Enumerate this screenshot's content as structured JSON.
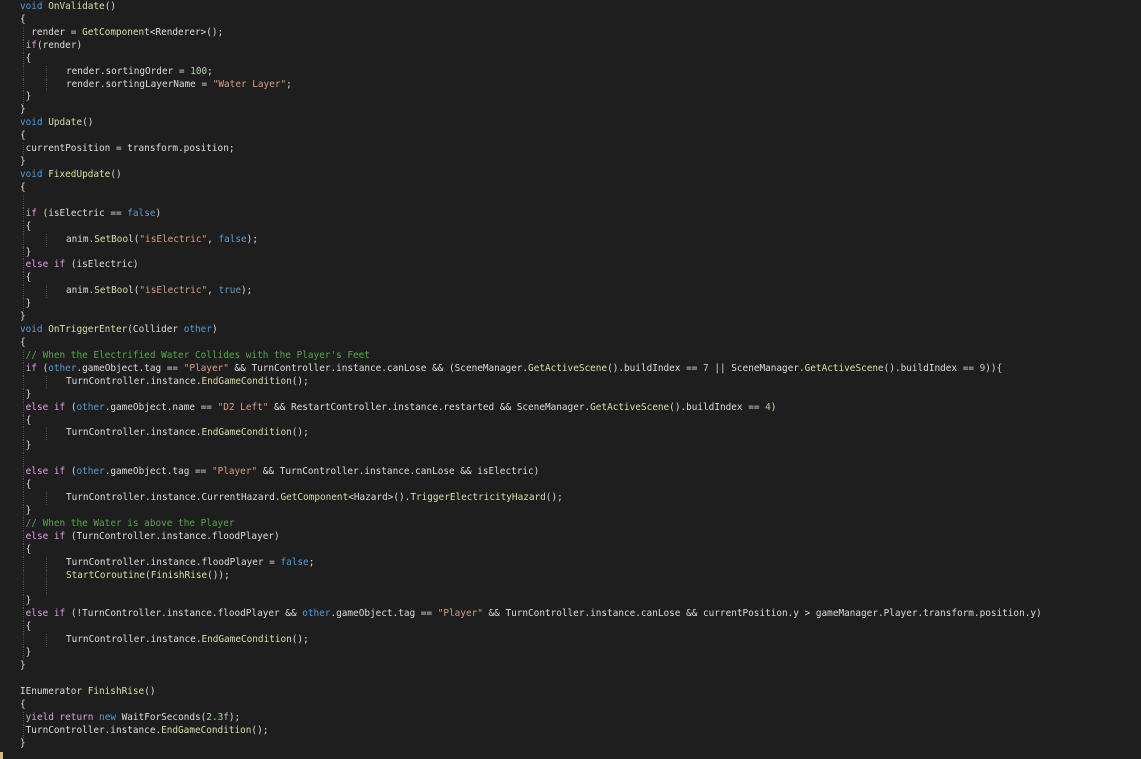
{
  "editor": {
    "theme": "dark",
    "colors": {
      "background": "#1e1e1e",
      "keyword": "#569cd6",
      "method": "#dcdcaa",
      "string": "#d69d85",
      "number": "#b5cea8",
      "comment": "#57a64a",
      "control": "#d8a0df",
      "text": "#dcdcdc",
      "indent_guide": "#4a4a4a"
    },
    "lines": [
      {
        "indent": 0,
        "tokens": [
          [
            "kw",
            "void"
          ],
          [
            "plain",
            " "
          ],
          [
            "fn",
            "OnValidate"
          ],
          [
            "pun",
            "()"
          ]
        ]
      },
      {
        "indent": 0,
        "tokens": [
          [
            "pun",
            "{"
          ]
        ]
      },
      {
        "indent": 1,
        "tokens": [
          [
            "plain",
            "  render = "
          ],
          [
            "fn",
            "GetComponent"
          ],
          [
            "pun",
            "<"
          ],
          [
            "plain",
            "Renderer"
          ],
          [
            "pun",
            ">();"
          ]
        ]
      },
      {
        "indent": 1,
        "tokens": [
          [
            "plain",
            " "
          ],
          [
            "ctl",
            "if"
          ],
          [
            "pun",
            "("
          ],
          [
            "plain",
            "render"
          ],
          [
            "pun",
            ")"
          ]
        ]
      },
      {
        "indent": 1,
        "tokens": [
          [
            "plain",
            " "
          ],
          [
            "pun",
            "{"
          ]
        ]
      },
      {
        "indent": 2,
        "tokens": [
          [
            "plain",
            "render.sortingOrder = "
          ],
          [
            "num",
            "100"
          ],
          [
            "pun",
            ";"
          ]
        ]
      },
      {
        "indent": 2,
        "tokens": [
          [
            "plain",
            "render.sortingLayerName = "
          ],
          [
            "str",
            "\"Water Layer\""
          ],
          [
            "pun",
            ";"
          ]
        ]
      },
      {
        "indent": 1,
        "tokens": [
          [
            "plain",
            " "
          ],
          [
            "pun",
            "}"
          ]
        ]
      },
      {
        "indent": 0,
        "tokens": [
          [
            "pun",
            "}"
          ]
        ]
      },
      {
        "indent": 0,
        "tokens": [
          [
            "kw",
            "void"
          ],
          [
            "plain",
            " "
          ],
          [
            "fn",
            "Update"
          ],
          [
            "pun",
            "()"
          ]
        ]
      },
      {
        "indent": 0,
        "tokens": [
          [
            "pun",
            "{"
          ]
        ]
      },
      {
        "indent": 1,
        "tokens": [
          [
            "plain",
            " currentPosition = transform.position;"
          ]
        ]
      },
      {
        "indent": 0,
        "tokens": [
          [
            "pun",
            "}"
          ]
        ]
      },
      {
        "indent": 0,
        "tokens": [
          [
            "kw",
            "void"
          ],
          [
            "plain",
            " "
          ],
          [
            "fn",
            "FixedUpdate"
          ],
          [
            "pun",
            "()"
          ]
        ]
      },
      {
        "indent": 0,
        "tokens": [
          [
            "pun",
            "{"
          ]
        ]
      },
      {
        "indent": 1,
        "tokens": []
      },
      {
        "indent": 1,
        "tokens": [
          [
            "plain",
            " "
          ],
          [
            "ctl",
            "if"
          ],
          [
            "plain",
            " (isElectric == "
          ],
          [
            "kw",
            "false"
          ],
          [
            "pun",
            ")"
          ]
        ]
      },
      {
        "indent": 1,
        "tokens": [
          [
            "plain",
            " "
          ],
          [
            "pun",
            "{"
          ]
        ]
      },
      {
        "indent": 2,
        "tokens": [
          [
            "plain",
            "anim."
          ],
          [
            "fn",
            "SetBool"
          ],
          [
            "pun",
            "("
          ],
          [
            "str",
            "\"isElectric\""
          ],
          [
            "pun",
            ", "
          ],
          [
            "kw",
            "false"
          ],
          [
            "pun",
            ");"
          ]
        ]
      },
      {
        "indent": 1,
        "tokens": [
          [
            "plain",
            " "
          ],
          [
            "pun",
            "}"
          ]
        ]
      },
      {
        "indent": 1,
        "tokens": [
          [
            "plain",
            " "
          ],
          [
            "ctl",
            "else if"
          ],
          [
            "plain",
            " (isElectric)"
          ]
        ]
      },
      {
        "indent": 1,
        "tokens": [
          [
            "plain",
            " "
          ],
          [
            "pun",
            "{"
          ]
        ]
      },
      {
        "indent": 2,
        "tokens": [
          [
            "plain",
            "anim."
          ],
          [
            "fn",
            "SetBool"
          ],
          [
            "pun",
            "("
          ],
          [
            "str",
            "\"isElectric\""
          ],
          [
            "pun",
            ", "
          ],
          [
            "kw",
            "true"
          ],
          [
            "pun",
            ");"
          ]
        ]
      },
      {
        "indent": 1,
        "tokens": [
          [
            "plain",
            " "
          ],
          [
            "pun",
            "}"
          ]
        ]
      },
      {
        "indent": 0,
        "tokens": [
          [
            "pun",
            "}"
          ]
        ]
      },
      {
        "indent": 0,
        "tokens": [
          [
            "kw",
            "void"
          ],
          [
            "plain",
            " "
          ],
          [
            "fn",
            "OnTriggerEnter"
          ],
          [
            "pun",
            "("
          ],
          [
            "plain",
            "Collider "
          ],
          [
            "kw",
            "other"
          ],
          [
            "pun",
            ")"
          ]
        ]
      },
      {
        "indent": 0,
        "tokens": [
          [
            "pun",
            "{"
          ]
        ]
      },
      {
        "indent": 1,
        "tokens": [
          [
            "plain",
            " "
          ],
          [
            "cmt",
            "// When the Electrified Water Collides with the Player's Feet"
          ]
        ]
      },
      {
        "indent": 1,
        "tokens": [
          [
            "plain",
            " "
          ],
          [
            "ctl",
            "if"
          ],
          [
            "plain",
            " ("
          ],
          [
            "kw",
            "other"
          ],
          [
            "plain",
            ".gameObject.tag == "
          ],
          [
            "str",
            "\"Player\""
          ],
          [
            "plain",
            " && TurnController.instance.canLose && (SceneManager."
          ],
          [
            "fn",
            "GetActiveScene"
          ],
          [
            "plain",
            "().buildIndex == "
          ],
          [
            "num",
            "7"
          ],
          [
            "plain",
            " || SceneManager."
          ],
          [
            "fn",
            "GetActiveScene"
          ],
          [
            "plain",
            "().buildIndex == "
          ],
          [
            "num",
            "9"
          ],
          [
            "pun",
            "))"
          ],
          [
            "pun",
            "{"
          ]
        ]
      },
      {
        "indent": 2,
        "tokens": [
          [
            "plain",
            "TurnController.instance."
          ],
          [
            "fn",
            "EndGameCondition"
          ],
          [
            "pun",
            "();"
          ]
        ]
      },
      {
        "indent": 1,
        "tokens": [
          [
            "plain",
            " "
          ],
          [
            "pun",
            "}"
          ]
        ]
      },
      {
        "indent": 1,
        "tokens": [
          [
            "plain",
            " "
          ],
          [
            "ctl",
            "else if"
          ],
          [
            "plain",
            " ("
          ],
          [
            "kw",
            "other"
          ],
          [
            "plain",
            ".gameObject.name == "
          ],
          [
            "str",
            "\"D2 Left\""
          ],
          [
            "plain",
            " && RestartController.instance.restarted && SceneManager."
          ],
          [
            "fn",
            "GetActiveScene"
          ],
          [
            "plain",
            "().buildIndex == "
          ],
          [
            "num",
            "4"
          ],
          [
            "pun",
            ")"
          ]
        ]
      },
      {
        "indent": 1,
        "tokens": [
          [
            "plain",
            " "
          ],
          [
            "pun",
            "{"
          ]
        ]
      },
      {
        "indent": 2,
        "tokens": [
          [
            "plain",
            "TurnController.instance."
          ],
          [
            "fn",
            "EndGameCondition"
          ],
          [
            "pun",
            "();"
          ]
        ]
      },
      {
        "indent": 1,
        "tokens": [
          [
            "plain",
            " "
          ],
          [
            "pun",
            "}"
          ]
        ]
      },
      {
        "indent": 1,
        "tokens": []
      },
      {
        "indent": 1,
        "tokens": [
          [
            "plain",
            " "
          ],
          [
            "ctl",
            "else if"
          ],
          [
            "plain",
            " ("
          ],
          [
            "kw",
            "other"
          ],
          [
            "plain",
            ".gameObject.tag == "
          ],
          [
            "str",
            "\"Player\""
          ],
          [
            "plain",
            " && TurnController.instance.canLose && isElectric)"
          ]
        ]
      },
      {
        "indent": 1,
        "tokens": [
          [
            "plain",
            " "
          ],
          [
            "pun",
            "{"
          ]
        ]
      },
      {
        "indent": 2,
        "tokens": [
          [
            "plain",
            "TurnController.instance.CurrentHazard."
          ],
          [
            "fn",
            "GetComponent"
          ],
          [
            "pun",
            "<"
          ],
          [
            "plain",
            "Hazard"
          ],
          [
            "pun",
            ">()."
          ],
          [
            "fn",
            "TriggerElectricityHazard"
          ],
          [
            "pun",
            "();"
          ]
        ]
      },
      {
        "indent": 1,
        "tokens": [
          [
            "plain",
            " "
          ],
          [
            "pun",
            "}"
          ]
        ]
      },
      {
        "indent": 1,
        "tokens": [
          [
            "plain",
            " "
          ],
          [
            "cmt",
            "// When the Water is above the Player"
          ]
        ]
      },
      {
        "indent": 1,
        "tokens": [
          [
            "plain",
            " "
          ],
          [
            "ctl",
            "else if"
          ],
          [
            "plain",
            " (TurnController.instance.floodPlayer)"
          ]
        ]
      },
      {
        "indent": 1,
        "tokens": [
          [
            "plain",
            " "
          ],
          [
            "pun",
            "{"
          ]
        ]
      },
      {
        "indent": 2,
        "tokens": [
          [
            "plain",
            "TurnController.instance.floodPlayer = "
          ],
          [
            "kw",
            "false"
          ],
          [
            "pun",
            ";"
          ]
        ]
      },
      {
        "indent": 2,
        "tokens": [
          [
            "fn",
            "StartCoroutine"
          ],
          [
            "pun",
            "("
          ],
          [
            "fn",
            "FinishRise"
          ],
          [
            "pun",
            "());"
          ]
        ]
      },
      {
        "indent": 2,
        "tokens": []
      },
      {
        "indent": 1,
        "tokens": [
          [
            "plain",
            " "
          ],
          [
            "pun",
            "}"
          ]
        ]
      },
      {
        "indent": 1,
        "tokens": [
          [
            "plain",
            " "
          ],
          [
            "ctl",
            "else if"
          ],
          [
            "plain",
            " (!TurnController.instance.floodPlayer && "
          ],
          [
            "kw",
            "other"
          ],
          [
            "plain",
            ".gameObject.tag == "
          ],
          [
            "str",
            "\"Player\""
          ],
          [
            "plain",
            " && TurnController.instance.canLose && currentPosition.y > gameManager.Player.transform.position.y)"
          ]
        ]
      },
      {
        "indent": 1,
        "tokens": [
          [
            "plain",
            " "
          ],
          [
            "pun",
            "{"
          ]
        ]
      },
      {
        "indent": 2,
        "tokens": [
          [
            "plain",
            "TurnController.instance."
          ],
          [
            "fn",
            "EndGameCondition"
          ],
          [
            "pun",
            "();"
          ]
        ]
      },
      {
        "indent": 1,
        "tokens": [
          [
            "plain",
            " "
          ],
          [
            "pun",
            "}"
          ]
        ]
      },
      {
        "indent": 0,
        "tokens": [
          [
            "pun",
            "}"
          ]
        ]
      },
      {
        "indent": 0,
        "tokens": []
      },
      {
        "indent": 0,
        "tokens": [
          [
            "plain",
            "IEnumerator "
          ],
          [
            "fn",
            "FinishRise"
          ],
          [
            "pun",
            "()"
          ]
        ]
      },
      {
        "indent": 0,
        "tokens": [
          [
            "pun",
            "{"
          ]
        ]
      },
      {
        "indent": 1,
        "tokens": [
          [
            "plain",
            " "
          ],
          [
            "ctl",
            "yield return"
          ],
          [
            "plain",
            " "
          ],
          [
            "kw",
            "new"
          ],
          [
            "plain",
            " WaitForSeconds("
          ],
          [
            "num",
            "2.3f"
          ],
          [
            "pun",
            ");"
          ]
        ]
      },
      {
        "indent": 1,
        "tokens": [
          [
            "plain",
            " TurnController.instance."
          ],
          [
            "fn",
            "EndGameCondition"
          ],
          [
            "pun",
            "();"
          ]
        ]
      },
      {
        "indent": 0,
        "tokens": [
          [
            "pun",
            "}"
          ]
        ]
      }
    ]
  }
}
